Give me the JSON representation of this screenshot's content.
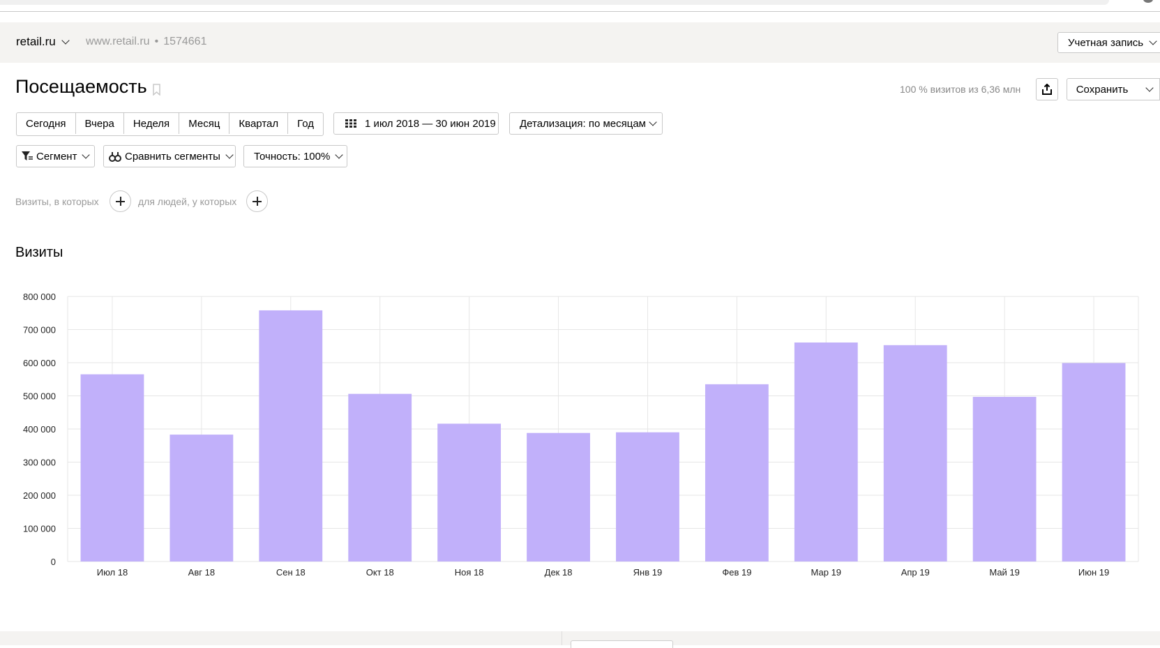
{
  "header": {
    "site_name": "retail.ru",
    "site_url": "www.retail.ru",
    "counter_id": "1574661",
    "account_label": "Учетная запись"
  },
  "report": {
    "title": "Посещаемость",
    "coverage": "100 % визитов из 6,36 млн",
    "save_label": "Сохранить"
  },
  "period_buttons": [
    "Сегодня",
    "Вчера",
    "Неделя",
    "Месяц",
    "Квартал",
    "Год"
  ],
  "date_range": "1 июл 2018 — 30 июн 2019",
  "detail": "Детализация: по месяцам",
  "segment": {
    "segment_label": "Сегмент",
    "compare_label": "Сравнить сегменты",
    "accuracy_label": "Точность: 100%"
  },
  "conditions": {
    "visits_label": "Визиты, в которых",
    "people_label": "для людей, у которых"
  },
  "colors": {
    "bar": "#c1b0fa",
    "grid": "#e6e6e6"
  },
  "chart_data": {
    "type": "bar",
    "title": "Визиты",
    "categories": [
      "Июл 18",
      "Авг 18",
      "Сен 18",
      "Окт 18",
      "Ноя 18",
      "Дек 18",
      "Янв 19",
      "Фев 19",
      "Мар 19",
      "Апр 19",
      "Май 19",
      "Июн 19"
    ],
    "series": [
      {
        "values": [
          565000,
          383000,
          758000,
          506000,
          416000,
          388000,
          390000,
          535000,
          661000,
          653000,
          497000,
          599000
        ]
      }
    ],
    "ylim": [
      0,
      800000
    ],
    "yticks": [
      "0",
      "100 000",
      "200 000",
      "300 000",
      "400 000",
      "500 000",
      "600 000",
      "700 000",
      "800 000"
    ],
    "grid": true
  }
}
